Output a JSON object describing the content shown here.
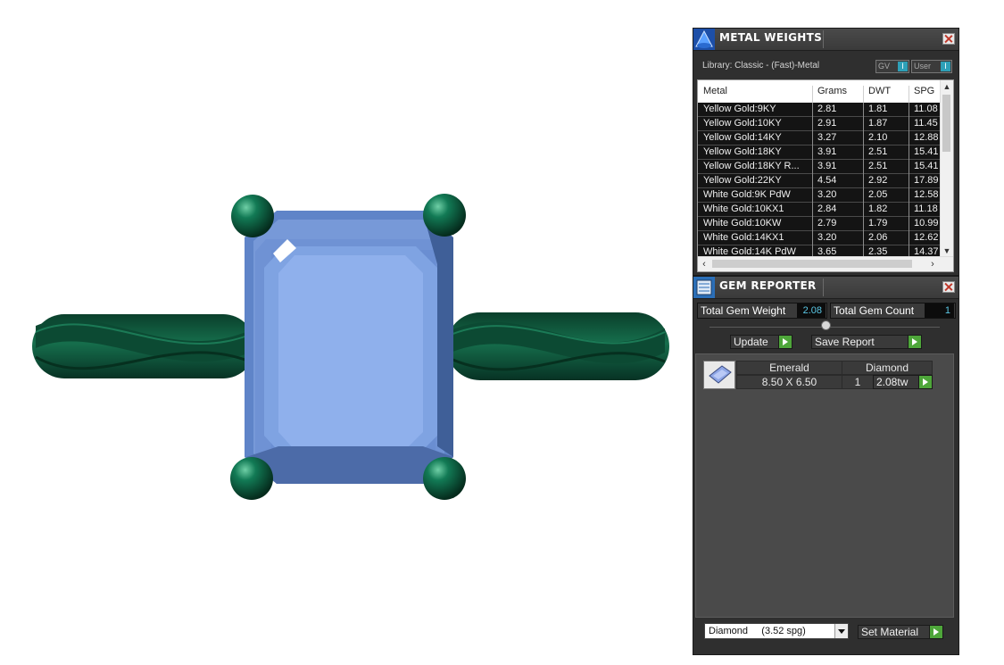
{
  "metal_weights": {
    "title": "METAL WEIGHTS",
    "library_label": "Library: Classic - (Fast)-Metal",
    "toggle_gv": "GV",
    "toggle_user": "User",
    "toggle_knob": "I",
    "columns": [
      "Metal",
      "Grams",
      "DWT",
      "SPG"
    ],
    "rows": [
      {
        "metal": "Yellow Gold:9KY",
        "grams": "2.81",
        "dwt": "1.81",
        "spg": "11.08"
      },
      {
        "metal": "Yellow Gold:10KY",
        "grams": "2.91",
        "dwt": "1.87",
        "spg": "11.45"
      },
      {
        "metal": "Yellow Gold:14KY",
        "grams": "3.27",
        "dwt": "2.10",
        "spg": "12.88"
      },
      {
        "metal": "Yellow Gold:18KY",
        "grams": "3.91",
        "dwt": "2.51",
        "spg": "15.41"
      },
      {
        "metal": "Yellow Gold:18KY R...",
        "grams": "3.91",
        "dwt": "2.51",
        "spg": "15.41"
      },
      {
        "metal": "Yellow Gold:22KY",
        "grams": "4.54",
        "dwt": "2.92",
        "spg": "17.89"
      },
      {
        "metal": "White Gold:9K PdW",
        "grams": "3.20",
        "dwt": "2.05",
        "spg": "12.58"
      },
      {
        "metal": "White Gold:10KX1",
        "grams": "2.84",
        "dwt": "1.82",
        "spg": "11.18"
      },
      {
        "metal": "White Gold:10KW",
        "grams": "2.79",
        "dwt": "1.79",
        "spg": "10.99"
      },
      {
        "metal": "White Gold:14KX1",
        "grams": "3.20",
        "dwt": "2.06",
        "spg": "12.62"
      },
      {
        "metal": "White Gold:14K PdW",
        "grams": "3.65",
        "dwt": "2.35",
        "spg": "14.37"
      }
    ]
  },
  "gem_reporter": {
    "title": "GEM REPORTER",
    "total_weight_label": "Total Gem Weight",
    "total_weight_value": "2.08",
    "total_count_label": "Total Gem Count",
    "total_count_value": "1",
    "update_label": "Update",
    "save_report_label": "Save Report",
    "gem": {
      "cut": "Emerald",
      "material": "Diamond",
      "size": "8.50 X 6.50",
      "count": "1",
      "weight": "2.08tw"
    },
    "material_select": "Diamond     (3.52 spg)",
    "set_material_label": "Set Material"
  },
  "colors": {
    "gem_blue": "#8fb0ec",
    "metal_green": "#0f5a3f",
    "panel_bg": "#2f2f2f",
    "accent_cyan": "#2ea0b8",
    "go_green": "#4ea63a"
  },
  "icons": [
    "metal-weights-icon",
    "gem-reporter-icon",
    "close-icon",
    "go-arrow-icon",
    "dropdown-arrow-icon"
  ]
}
